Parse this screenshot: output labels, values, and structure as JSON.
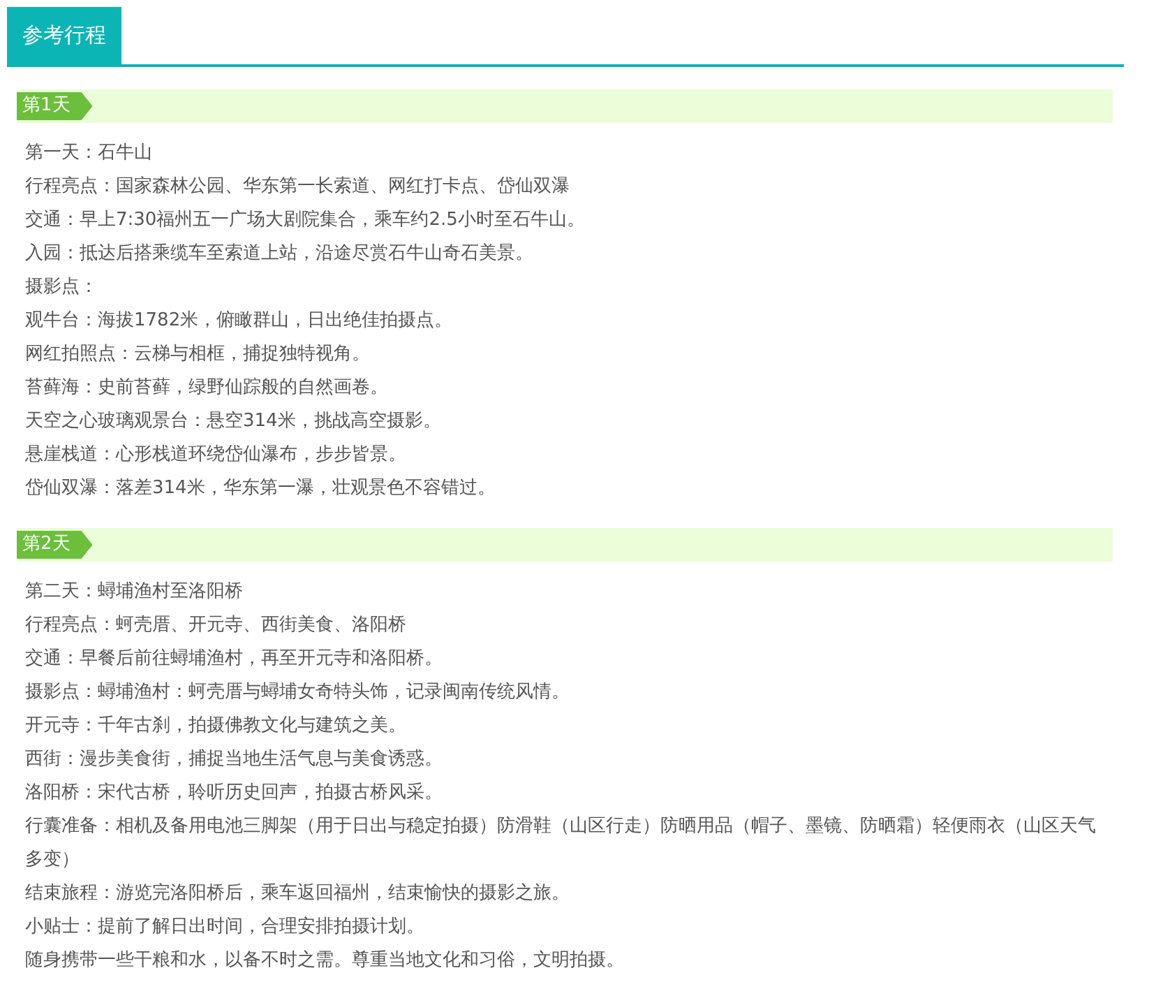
{
  "tab": {
    "label": "参考行程",
    "selected": true
  },
  "days": [
    {
      "label": "第1天",
      "lines": [
        "第一天：石牛山",
        "行程亮点：国家森林公园、华东第一长索道、网红打卡点、岱仙双瀑",
        "交通：早上7:30福州五一广场大剧院集合，乘车约2.5小时至石牛山。",
        "入园：抵达后搭乘缆车至索道上站，沿途尽赏石牛山奇石美景。",
        "摄影点：",
        "观牛台：海拔1782米，俯瞰群山，日出绝佳拍摄点。",
        "网红拍照点：云梯与相框，捕捉独特视角。",
        "苔藓海：史前苔藓，绿野仙踪般的自然画卷。",
        "天空之心玻璃观景台：悬空314米，挑战高空摄影。",
        "悬崖栈道：心形栈道环绕岱仙瀑布，步步皆景。",
        "岱仙双瀑：落差314米，华东第一瀑，壮观景色不容错过。"
      ]
    },
    {
      "label": "第2天",
      "lines": [
        "第二天：蟳埔渔村至洛阳桥",
        "行程亮点：蚵壳厝、开元寺、西街美食、洛阳桥",
        "交通：早餐后前往蟳埔渔村，再至开元寺和洛阳桥。",
        "摄影点：蟳埔渔村：蚵壳厝与蟳埔女奇特头饰，记录闽南传统风情。",
        "开元寺：千年古刹，拍摄佛教文化与建筑之美。",
        "西街：漫步美食街，捕捉当地生活气息与美食诱惑。",
        "洛阳桥：宋代古桥，聆听历史回声，拍摄古桥风采。",
        "行囊准备：相机及备用电池三脚架（用于日出与稳定拍摄）防滑鞋（山区行走）防晒用品（帽子、墨镜、防晒霜）轻便雨衣（山区天气多变）",
        "结束旅程：游览完洛阳桥后，乘车返回福州，结束愉快的摄影之旅。",
        "小贴士：提前了解日出时间，合理安排拍摄计划。",
        "随身携带一些干粮和水，以备不时之需。尊重当地文化和习俗，文明拍摄。"
      ]
    }
  ]
}
